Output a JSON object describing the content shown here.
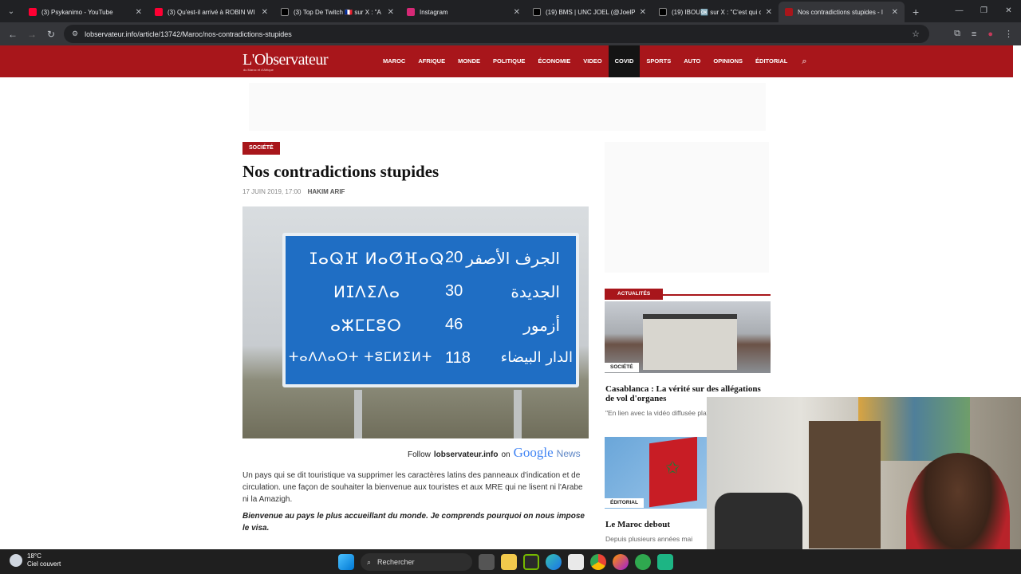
{
  "browser": {
    "tabs": [
      {
        "title": "(3) Psykanimo - YouTube",
        "favicon_color": "#ff0033"
      },
      {
        "title": "(3) Qu'est-il arrivé à ROBIN WI",
        "favicon_color": "#ff0033"
      },
      {
        "title": "(3) Top De Twitch 🇫🇷 sur X : \"A",
        "favicon_color": "#000000"
      },
      {
        "title": "Instagram",
        "favicon_color": "#d62976"
      },
      {
        "title": "(19) BMS | UNC JOEL (@JoelPo",
        "favicon_color": "#000000"
      },
      {
        "title": "(19) IBOU🆗 sur X : \"C'est qui c",
        "favicon_color": "#000000"
      },
      {
        "title": "Nos contradictions stupides - l",
        "favicon_color": "#a8161b",
        "active": true
      }
    ],
    "url": "lobservateur.info/article/13742/Maroc/nos-contradictions-stupides"
  },
  "site": {
    "logo": "L'Observateur",
    "logo_sub": "du Maroc et d'Afrique",
    "nav": [
      "MAROC",
      "AFRIQUE",
      "MONDE",
      "POLITIQUE",
      "ÉCONOMIE",
      "VIDEO",
      "COVID",
      "SPORTS",
      "AUTO",
      "OPINIONS",
      "ÉDITORIAL"
    ],
    "nav_active": "COVID",
    "brand_color": "#a8161b"
  },
  "article": {
    "category": "SOCIÉTÉ",
    "title": "Nos contradictions stupides",
    "date": "17 JUIN 2019, 17:00",
    "author": "HAKIM ARIF",
    "sign": [
      {
        "tifinagh": "ⵊⴰⵕⴼ ⵍⴰⵚⴼⴰⵕ",
        "km": "20",
        "arabic": "الجرف الأصفر"
      },
      {
        "tifinagh": "ⵍⵊⴷⵉⴷⴰ",
        "km": "30",
        "arabic": "الجديدة"
      },
      {
        "tifinagh": "ⴰⵣⵎⵎⵓⵔ",
        "km": "46",
        "arabic": "أزمور"
      },
      {
        "tifinagh": "ⵜⴰⴷⴷⴰⵔⵜ ⵜⵓⵎⵍⵉⵍⵜ",
        "km": "118",
        "arabic": "الدار البيضاء"
      }
    ],
    "follow_prefix": "Follow",
    "follow_site": "lobservateur.info",
    "follow_on": "on",
    "follow_google": "Google",
    "follow_news": "News",
    "paragraph1": "Un pays qui se dit touristique va supprimer les caractères latins des panneaux d'indication et de circulation. une façon de souhaiter la bienvenue aux touristes et aux MRE qui ne lisent ni l'Arabe ni la Amazigh.",
    "paragraph2": "Bienvenue au pays le plus accueillant du monde. Je comprends pourquoi on nous impose le visa."
  },
  "sidebar": {
    "section_label": "ACTUALITÉS",
    "cards": [
      {
        "tag": "SOCIÉTÉ",
        "title": "Casablanca : La vérité sur des allégations de vol d'organes",
        "excerpt": "\"En lien avec la vidéo diffusée plateformes de réseaux socia"
      },
      {
        "tag": "ÉDITORIAL",
        "title": "Le Maroc debout",
        "excerpt": "Depuis plusieurs années mai"
      }
    ]
  },
  "taskbar": {
    "temperature": "18°C",
    "condition": "Ciel couvert",
    "search_placeholder": "Rechercher"
  }
}
